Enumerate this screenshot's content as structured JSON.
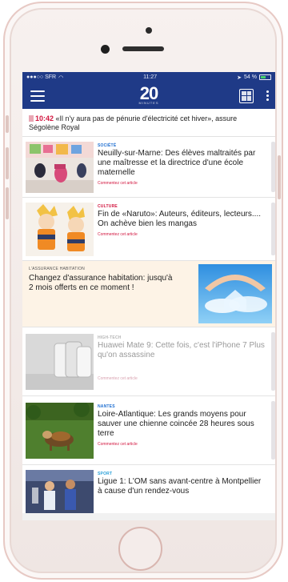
{
  "status_bar": {
    "carrier": "●●●○○ SFR",
    "time": "11:27",
    "battery": "54 %"
  },
  "header": {
    "logo_number": "20",
    "logo_sub": "MINUTES",
    "menu_icon": "hamburger-icon",
    "newspaper_icon": "newspaper-icon",
    "more_icon": "vertical-dots-icon"
  },
  "breaking": {
    "time": "10:42",
    "text": "«Il n'y aura pas de pénurie d'électricité cet hiver», assure Ségolène Royal"
  },
  "articles": [
    {
      "category": "SOCIÉTÉ",
      "category_color": "#1f6fd1",
      "title": "Neuilly-sur-Marne: Des élèves maltraités par une maîtresse et la directrice d'une école maternelle",
      "comment": "Commentez cet article"
    },
    {
      "category": "CULTURE",
      "category_color": "#d2163f",
      "title": "Fin de «Naruto»: Auteurs, éditeurs, lecteurs.... On achève bien les mangas",
      "comment": "Commentez cet article"
    },
    {
      "category": "HIGH-TECH",
      "category_color": "#b5b5b5",
      "title": "Huawei Mate 9: Cette fois, c'est l'iPhone 7 Plus qu'on assassine",
      "comment": "Commentez cet article"
    },
    {
      "category": "NANTES",
      "category_color": "#1f6fd1",
      "title": "Loire-Atlantique: Les grands moyens pour sauver une chienne coincée 28 heures sous terre",
      "comment": "Commentez cet article"
    },
    {
      "category": "SPORT",
      "category_color": "#2aa0d8",
      "title": "Ligue 1: L'OM sans avant-centre à Montpellier à cause d'un rendez-vous"
    }
  ],
  "ad": {
    "label": "L'ASSURANCE HABITATION",
    "text": "Changez d'assurance habitation: jusqu'à 2 mois offerts en ce moment !"
  }
}
